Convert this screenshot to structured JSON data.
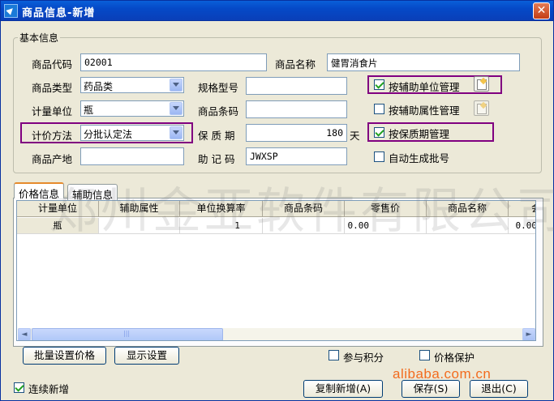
{
  "window": {
    "title": "商品信息-新增",
    "close_glyph": "✕"
  },
  "basic": {
    "legend": "基本信息",
    "product_code": {
      "label": "商品代码",
      "value": "02001"
    },
    "product_name": {
      "label": "商品名称",
      "value": "健胃消食片"
    },
    "product_type": {
      "label": "商品类型",
      "value": "药品类"
    },
    "spec_model": {
      "label": "规格型号",
      "value": ""
    },
    "unit": {
      "label": "计量单位",
      "value": "瓶"
    },
    "barcode": {
      "label": "商品条码",
      "value": ""
    },
    "pricing_method": {
      "label": "计价方法",
      "value": "分批认定法"
    },
    "shelf_life": {
      "label": "保 质 期",
      "value": "180",
      "suffix": "天"
    },
    "origin": {
      "label": "商品产地",
      "value": ""
    },
    "mnemonic": {
      "label": "助 记 码",
      "value": "JWXSP"
    },
    "aux_unit": {
      "label": "按辅助单位管理",
      "checked": true
    },
    "aux_attr": {
      "label": "按辅助属性管理",
      "checked": false
    },
    "shelf_mgmt": {
      "label": "按保质期管理",
      "checked": true
    },
    "auto_batch": {
      "label": "自动生成批号",
      "checked": false
    }
  },
  "tabs": [
    {
      "label": "价格信息",
      "active": true
    },
    {
      "label": "辅助信息",
      "active": false
    }
  ],
  "grid": {
    "columns": [
      "计量单位",
      "辅助属性",
      "单位换算率",
      "商品条码",
      "零售价",
      "商品名称",
      "会"
    ],
    "rows": [
      [
        "瓶",
        "",
        "1",
        "",
        "0.00",
        "",
        "0.00"
      ]
    ],
    "scroll_left": "◄",
    "scroll_right": "►",
    "scroll_grip": "|||"
  },
  "buttons": {
    "batch_price": "批量设置价格",
    "display_settings": "显示设置",
    "copy_new": "复制新增(A)",
    "save": "保存(S)",
    "exit": "退出(C)"
  },
  "options": {
    "points": {
      "label": "参与积分",
      "checked": false
    },
    "price_protect": {
      "label": "价格保护",
      "checked": false
    },
    "continuous_add": {
      "label": "连续新增",
      "checked": true
    }
  },
  "watermark": "郑州金亚软件有限公司",
  "site_watermark": "alibaba.com.cn"
}
